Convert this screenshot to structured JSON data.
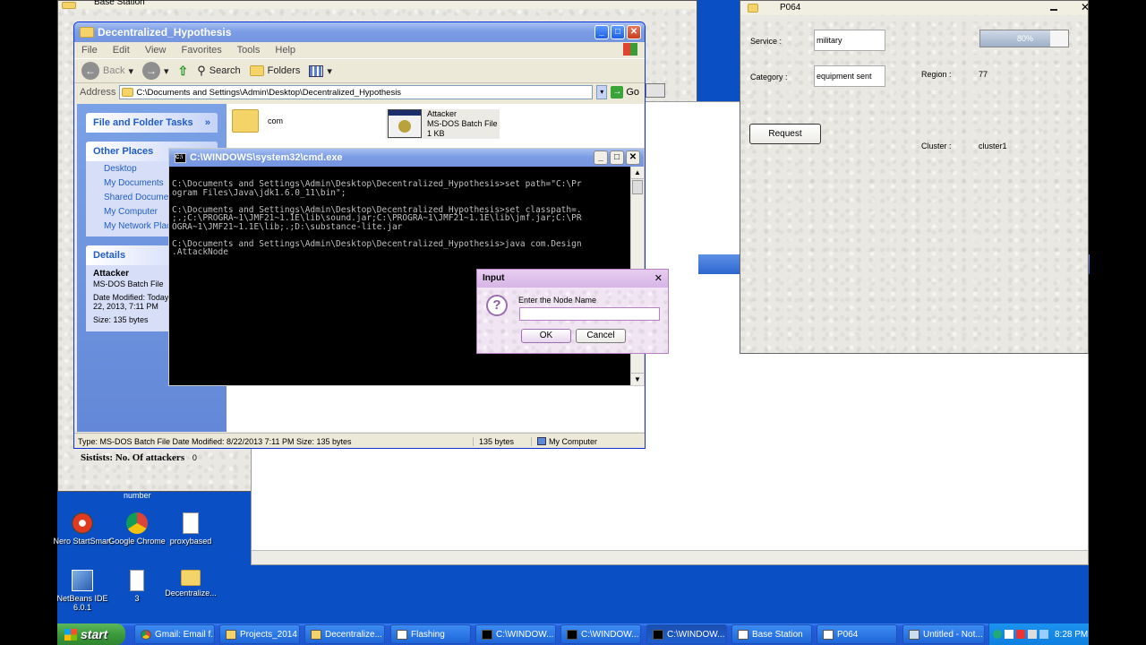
{
  "base_station": {
    "title": "Base Station",
    "stats_label": "Sistists: No. Of attackers",
    "stats_value": "0",
    "number_label": "number"
  },
  "p064": {
    "title": "P064",
    "service_label": "Service :",
    "service_value": "military",
    "category_label": "Category :",
    "category_value": "equipment sent",
    "progress_text": "80%",
    "progress": 0.8,
    "region_label": "Region :",
    "region_value": "77",
    "request_button": "Request",
    "cluster_label": "Cluster :",
    "cluster_value": "cluster1"
  },
  "explorer": {
    "title": "Decentralized_Hypothesis",
    "menu": [
      "File",
      "Edit",
      "View",
      "Favorites",
      "Tools",
      "Help"
    ],
    "toolbar": {
      "back": "Back",
      "search": "Search",
      "folders": "Folders"
    },
    "address_label": "Address",
    "address_value": "C:\\Documents and Settings\\Admin\\Desktop\\Decentralized_Hypothesis",
    "go_label": "Go",
    "tasks": {
      "file_folder_tasks": "File and Folder Tasks",
      "other_places": "Other Places",
      "places": [
        "Desktop",
        "My Documents",
        "Shared Documents",
        "My Computer",
        "My Network Places"
      ],
      "details": "Details",
      "details_name": "Attacker",
      "details_type": "MS-DOS Batch File",
      "details_modified": "Date Modified: Today, August 22, 2013, 7:11 PM",
      "details_size": "Size: 135 bytes"
    },
    "files": [
      {
        "name": "com"
      },
      {
        "name": "Attacker",
        "type": "MS-DOS Batch File",
        "size": "1 KB"
      }
    ],
    "status_text": "Type: MS-DOS Batch File Date Modified: 8/22/2013 7:11 PM Size: 135 bytes",
    "status_size": "135 bytes",
    "status_location": "My Computer"
  },
  "cmd": {
    "title": "C:\\WINDOWS\\system32\\cmd.exe",
    "text": "C:\\Documents and Settings\\Admin\\Desktop\\Decentralized_Hypothesis>set path=\"C:\\Pr\nogram Files\\Java\\jdk1.6.0_11\\bin\";\n\nC:\\Documents and Settings\\Admin\\Desktop\\Decentralized_Hypothesis>set classpath=.\n;.;C:\\PROGRA~1\\JMF21~1.1E\\lib\\sound.jar;C:\\PROGRA~1\\JMF21~1.1E\\lib\\jmf.jar;C:\\PR\nOGRA~1\\JMF21~1.1E\\lib;.;D:\\substance-lite.jar\n\nC:\\Documents and Settings\\Admin\\Desktop\\Decentralized_Hypothesis>java com.Design\n.AttackNode"
  },
  "input_dialog": {
    "title": "Input",
    "prompt": "Enter the Node Name",
    "value": "",
    "ok": "OK",
    "cancel": "Cancel"
  },
  "desktop_icons": [
    {
      "label": "Nero StartSmart"
    },
    {
      "label": "Google Chrome"
    },
    {
      "label": "proxybased"
    },
    {
      "label": "NetBeans IDE 6.0.1"
    },
    {
      "label": "3"
    },
    {
      "label": "Decentralize..."
    }
  ],
  "taskbar": {
    "start": "start",
    "buttons": [
      "Gmail: Email f...",
      "Projects_2014",
      "Decentralize...",
      "Flashing",
      "C:\\WINDOW...",
      "C:\\WINDOW...",
      "C:\\WINDOW...",
      "Base Station",
      "P064",
      "Untitled - Not..."
    ],
    "clock": "8:28 PM"
  },
  "colors": {
    "desktop": "#0a4fc4",
    "title_active": "#0553d6",
    "taskbar": "#245edb",
    "start": "#3c9b3c"
  }
}
